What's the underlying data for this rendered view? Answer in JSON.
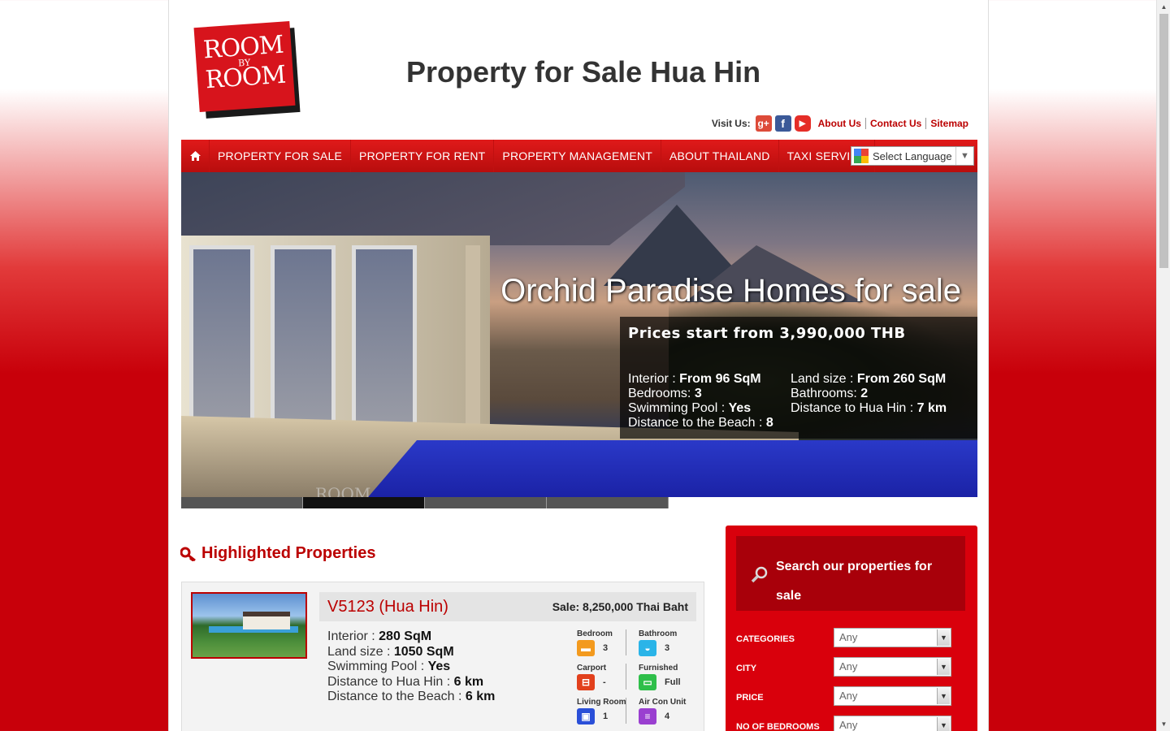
{
  "logo": {
    "line1": "ROOM",
    "line2": "BY",
    "line3": "ROOM"
  },
  "site_title": "Property for Sale Hua Hin",
  "topbar": {
    "visit_label": "Visit Us:",
    "social": [
      "google-plus-icon",
      "facebook-icon",
      "youtube-icon"
    ],
    "links": [
      "About Us",
      "Contact Us",
      "Sitemap"
    ]
  },
  "nav": {
    "home_icon": "home-icon",
    "items": [
      "PROPERTY FOR SALE",
      "PROPERTY FOR RENT",
      "PROPERTY MANAGEMENT",
      "ABOUT THAILAND",
      "TAXI SERVICE"
    ],
    "language_label": "Select Language"
  },
  "hero": {
    "heading": "Orchid Paradise Homes for sale",
    "price": "Prices start from 3,990,000 THB",
    "left": [
      {
        "label": "Interior : ",
        "value": "From 96 SqM"
      },
      {
        "label": "Bedrooms: ",
        "value": "3"
      },
      {
        "label": "Swimming Pool : ",
        "value": "Yes"
      },
      {
        "label": "Distance to the Beach : ",
        "value": "8"
      }
    ],
    "right": [
      {
        "label": "Land size : ",
        "value": "From 260 SqM"
      },
      {
        "label": "Bathrooms: ",
        "value": "2"
      },
      {
        "label": "Distance to Hua Hin : ",
        "value": "7 km"
      }
    ],
    "slides_total": 4,
    "slide_active": 2,
    "watermark": "ROOM"
  },
  "highlighted": {
    "title": "Highlighted Properties",
    "property": {
      "code": "V5123 (Hua Hin)",
      "sale": "Sale: 8,250,000 Thai Baht",
      "specs": [
        {
          "label": "Interior : ",
          "value": "280 SqM"
        },
        {
          "label": "Land size : ",
          "value": "1050 SqM"
        },
        {
          "label": "Swimming Pool : ",
          "value": "Yes"
        },
        {
          "label": "Distance to Hua Hin : ",
          "value": "6 km"
        },
        {
          "label": "Distance to the Beach : ",
          "value": "6 km"
        }
      ],
      "features": [
        {
          "label": "Bedroom",
          "value": "3",
          "color": "#f39a1e",
          "icon": "bed-icon"
        },
        {
          "label": "Bathroom",
          "value": "3",
          "color": "#2ab4e8",
          "icon": "bath-icon"
        },
        {
          "label": "Carport",
          "value": "-",
          "color": "#e2401c",
          "icon": "car-icon"
        },
        {
          "label": "Furnished",
          "value": "Full",
          "color": "#2fbf4a",
          "icon": "sofa-icon"
        },
        {
          "label": "Living Room",
          "value": "1",
          "color": "#2a4fd8",
          "icon": "tv-icon"
        },
        {
          "label": "Air Con Unit",
          "value": "4",
          "color": "#9a3fd0",
          "icon": "aircon-icon"
        }
      ]
    }
  },
  "search": {
    "title": "Search our properties for sale",
    "fields": [
      {
        "label": "CATEGORIES",
        "value": "Any"
      },
      {
        "label": "CITY",
        "value": "Any"
      },
      {
        "label": "PRICE",
        "value": "Any"
      },
      {
        "label": "NO OF BEDROOMS",
        "value": "Any"
      }
    ]
  }
}
